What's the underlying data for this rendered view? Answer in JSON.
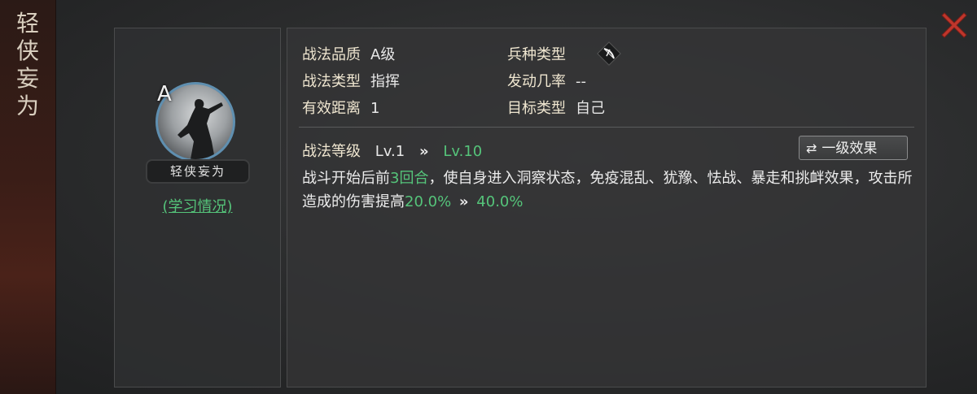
{
  "side_title": [
    "轻",
    "侠",
    "妄",
    "为"
  ],
  "skill": {
    "grade_letter": "A",
    "name": "轻侠妄为",
    "study_link": "(学习情况)"
  },
  "info": {
    "quality_label": "战法品质",
    "quality_value": "A级",
    "arms_label": "兵种类型",
    "arms_icon": "bow-icon",
    "type_label": "战法类型",
    "type_value": "指挥",
    "rate_label": "发动几率",
    "rate_value": "--",
    "range_label": "有效距离",
    "range_value": "1",
    "target_label": "目标类型",
    "target_value": "自己"
  },
  "level": {
    "label": "战法等级",
    "current": "Lv.1",
    "arrows": "»",
    "max": "Lv.10",
    "effect_button": "一级效果"
  },
  "description": {
    "p1": "战斗开始后前",
    "rounds": "3回合",
    "p2": "，使自身进入洞察状态，免疫混乱、犹豫、怯战、暴走和挑衅效果，攻击所造成的伤害提高",
    "dmg_from": "20.0%",
    "arrows": "»",
    "dmg_to": "40.0%"
  },
  "colors": {
    "highlight": "#55c47a",
    "close": "#c0362c"
  }
}
